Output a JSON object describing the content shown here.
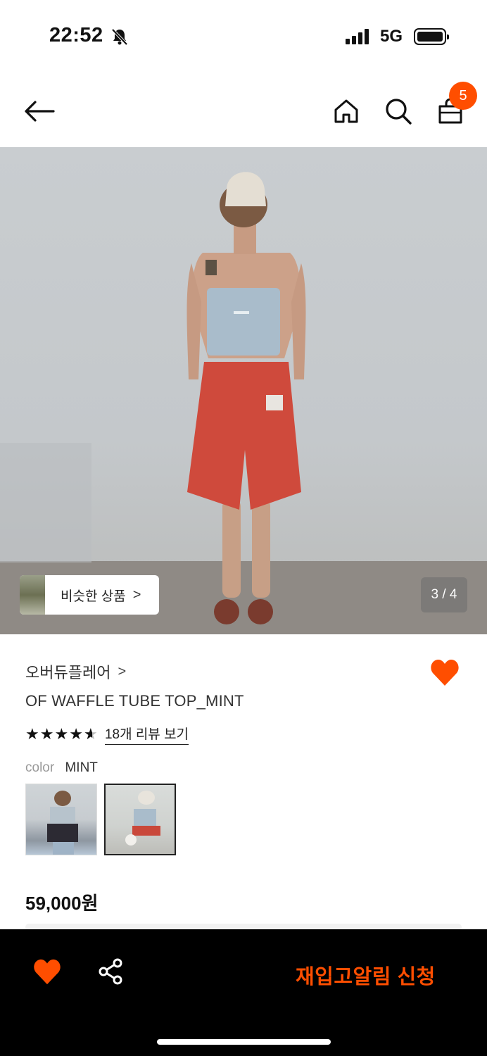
{
  "status_bar": {
    "time": "22:52",
    "network": "5G",
    "icons": [
      "bell-muted-icon",
      "signal-icon",
      "battery-icon"
    ]
  },
  "header": {
    "icons": [
      "back-arrow-icon",
      "home-icon",
      "search-icon",
      "shopping-bag-icon"
    ],
    "cart_count": "5"
  },
  "gallery": {
    "similar_products_label": "비슷한 상품",
    "similar_chevron": ">",
    "page_indicator": "3 / 4"
  },
  "product": {
    "brand": "오버듀플레어",
    "brand_chevron": ">",
    "name": "OF WAFFLE TUBE TOP_MINT",
    "rating": 4.5,
    "rating_stars": [
      "★",
      "★",
      "★",
      "★",
      "★"
    ],
    "reviews_link": "18개 리뷰 보기",
    "color_label": "color",
    "color_value": "MINT",
    "price": "59,000원",
    "wishlisted": true
  },
  "bottom_bar": {
    "restock_button": "재입고알림 신청",
    "icons": [
      "heart-icon",
      "share-icon"
    ]
  },
  "colors": {
    "accent": "#ff4e00",
    "bottom_bar_bg": "#000000"
  }
}
